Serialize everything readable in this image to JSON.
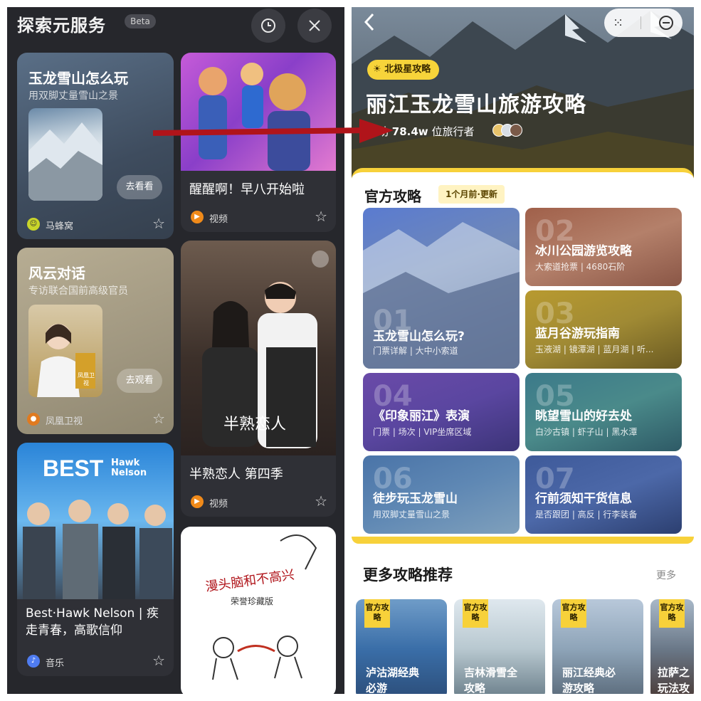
{
  "left": {
    "title": "探索元服务",
    "beta": "Beta",
    "history_icon": "clock-icon",
    "close_icon": "close-icon",
    "card1": {
      "title": "玉龙雪山怎么玩",
      "subtitle": "用双脚丈量雪山之景",
      "button": "去看看",
      "source": "马蜂窝"
    },
    "card2": {
      "title": "醒醒啊！早八开始啦",
      "source": "视频"
    },
    "card3": {
      "title": "风云对话",
      "subtitle": "专访联合国前高级官员",
      "button": "去观看",
      "source": "凤凰卫视",
      "thumb_text": "凤凰卫视"
    },
    "card4": {
      "title": "半熟恋人 第四季",
      "source": "视频",
      "poster_text": "半熟恋人"
    },
    "card5": {
      "title": "Best·Hawk Nelson | 疾走青春，高歌信仰",
      "source": "音乐",
      "logo": "BEST",
      "logo2": "Hawk Nelson"
    },
    "card6": {
      "poster_text": "漫头脑和不高兴",
      "poster_sub": "荣誉珍藏版"
    }
  },
  "right": {
    "back_icon": "back-icon",
    "tag": "北极星攻略",
    "hero_title": "丽江玉龙雪山旅游攻略",
    "helped_prefix": "帮助",
    "helped_count": "78.4w",
    "helped_suffix": "位旅行者",
    "official_title": "官方攻略",
    "updated": "1个月前·更新",
    "guides": [
      {
        "num": "01",
        "title": "玉龙雪山怎么玩?",
        "sub": "门票详解 | 大中小索道"
      },
      {
        "num": "02",
        "title": "冰川公园游览攻略",
        "sub": "大索道抢票 | 4680石阶"
      },
      {
        "num": "03",
        "title": "蓝月谷游玩指南",
        "sub": "玉液湖 | 镜潭湖 | 蓝月湖 | 听..."
      },
      {
        "num": "04",
        "title": "《印象丽江》表演",
        "sub": "门票 | 场次 | VIP坐席区域"
      },
      {
        "num": "05",
        "title": "眺望雪山的好去处",
        "sub": "白沙古镇 | 虾子山 | 黑水潭"
      },
      {
        "num": "06",
        "title": "徒步玩玉龙雪山",
        "sub": "用双脚丈量雪山之景"
      },
      {
        "num": "07",
        "title": "行前须知干货信息",
        "sub": "是否跟团 | 高反 | 行李装备"
      }
    ],
    "more_title": "更多攻略推荐",
    "more_link": "更多",
    "more_cards": [
      {
        "badge": "官方攻略",
        "title": "泸沽湖经典必游"
      },
      {
        "badge": "官方攻略",
        "title": "吉林滑雪全攻略"
      },
      {
        "badge": "官方攻略",
        "title": "丽江经典必游攻略"
      },
      {
        "badge": "官方攻略",
        "title": "拉萨之玩法攻"
      }
    ]
  },
  "colors": {
    "accent": "#f7d13a",
    "arrow": "#b0141a",
    "left_bg": "#26272c"
  }
}
